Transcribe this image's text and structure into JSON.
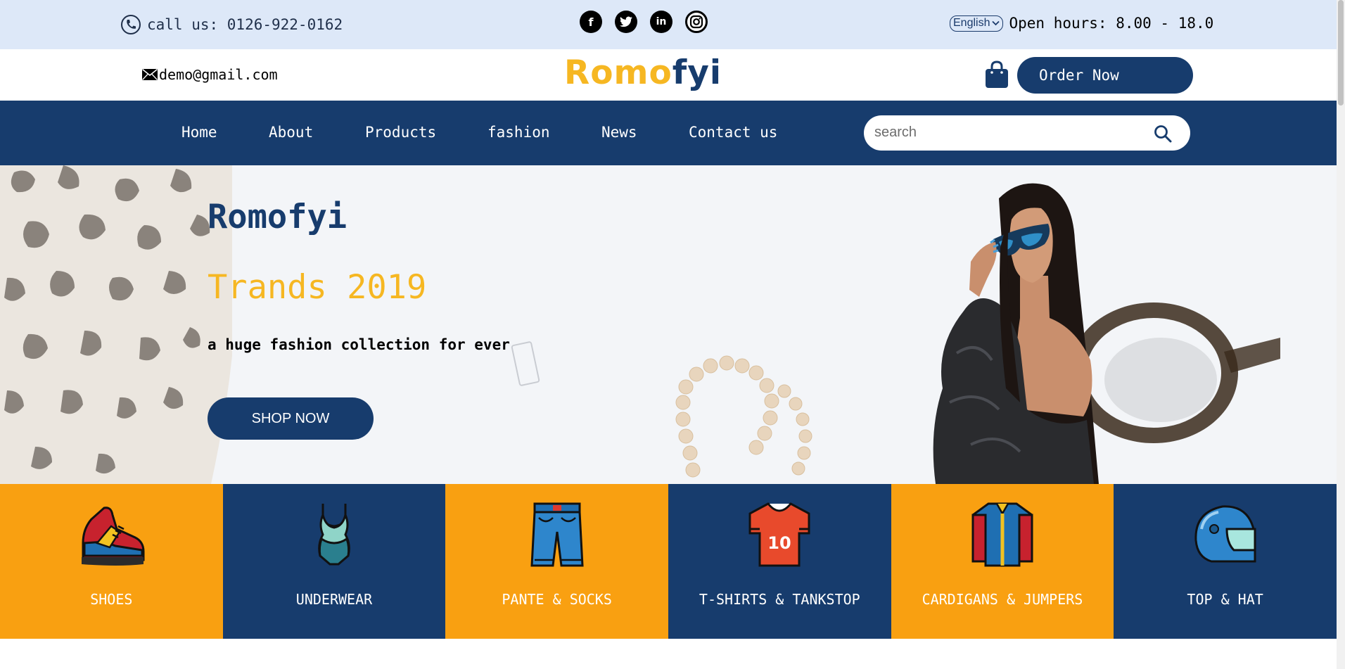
{
  "topbar": {
    "phone": "call us: 0126-922-0162",
    "socials": [
      {
        "name": "facebook-icon",
        "glyph": "f"
      },
      {
        "name": "twitter-icon",
        "glyph": "t"
      },
      {
        "name": "linkedin-icon",
        "glyph": "in"
      },
      {
        "name": "instagram-icon",
        "glyph": ""
      }
    ],
    "language": "English",
    "hours": "Open hours: 8.00 - 18.0"
  },
  "header": {
    "email": "demo@gmail.com",
    "logo_part1": "Romo",
    "logo_part2": "fyi",
    "order_label": "Order Now"
  },
  "nav": {
    "items": [
      "Home",
      "About",
      "Products",
      "fashion",
      "News",
      "Contact us"
    ],
    "search_placeholder": "search"
  },
  "hero": {
    "title": "Romofyi",
    "subtitle": "Trands 2019",
    "description": "a huge fashion collection for ever",
    "cta": "SHOP NOW"
  },
  "categories": [
    {
      "label": "SHOES",
      "icon": "sneaker-icon",
      "theme": "orange"
    },
    {
      "label": "UNDERWEAR",
      "icon": "swimsuit-icon",
      "theme": "navy"
    },
    {
      "label": "PANTE & SOCKS",
      "icon": "jeans-icon",
      "theme": "orange"
    },
    {
      "label": "T-SHIRTS & TANKSTOP",
      "icon": "jersey-icon",
      "theme": "navy"
    },
    {
      "label": "CARDIGANS & JUMPERS",
      "icon": "jacket-icon",
      "theme": "orange"
    },
    {
      "label": "TOP & HAT",
      "icon": "helmet-icon",
      "theme": "navy"
    }
  ],
  "colors": {
    "navy": "#173c6d",
    "orange": "#f9a011",
    "yellow": "#f6b722",
    "topbar_bg": "#dde8f8"
  }
}
